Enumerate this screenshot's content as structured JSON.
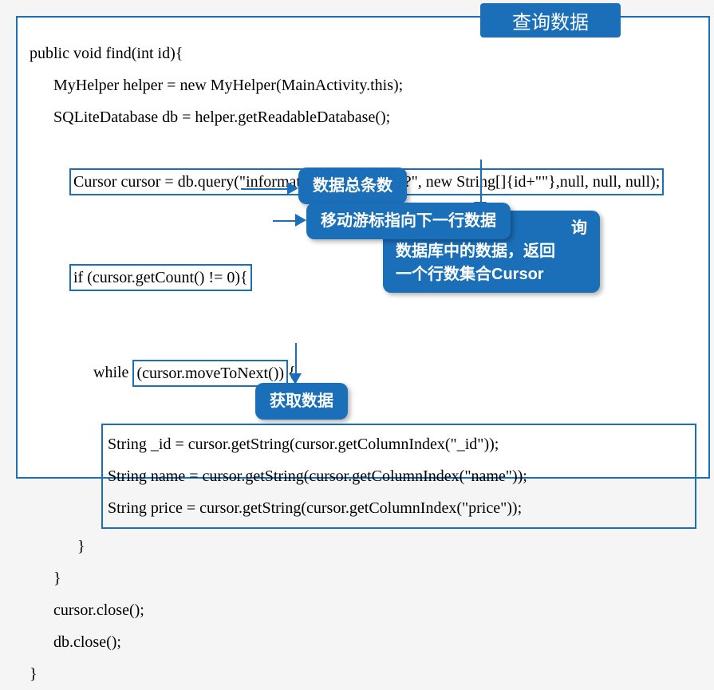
{
  "title": "查询数据",
  "code": {
    "l1": "public void find(int id){",
    "l2": "MyHelper helper = new MyHelper(MainActivity.this);",
    "l3": "SQLiteDatabase db = helper.getReadableDatabase();",
    "l4": "Cursor cursor = db.query(\"information\", null, \"_id=?\", new String[]{id+\"\"},null, null, null);",
    "l5a": "if (cursor.getCount() != 0){",
    "l6a": "while ",
    "l6b": "(cursor.moveToNext())",
    "l6c": "{",
    "l7": "String _id = cursor.getString(cursor.getColumnIndex(\"_id\"));",
    "l8": "String name = cursor.getString(cursor.getColumnIndex(\"name\"));",
    "l9": "String price = cursor.getString(cursor.getColumnIndex(\"price\"));",
    "l10": "}",
    "l11": "}",
    "l12": "cursor.close();",
    "l13": "db.close();",
    "l14": "}"
  },
  "callouts": {
    "count": "数据总条数",
    "moveNext": "移动游标指向下一行数据",
    "query1": "询",
    "query2": "数据库中的数据，返回",
    "query3": "一个行数集合Cursor",
    "getData": "获取数据"
  }
}
